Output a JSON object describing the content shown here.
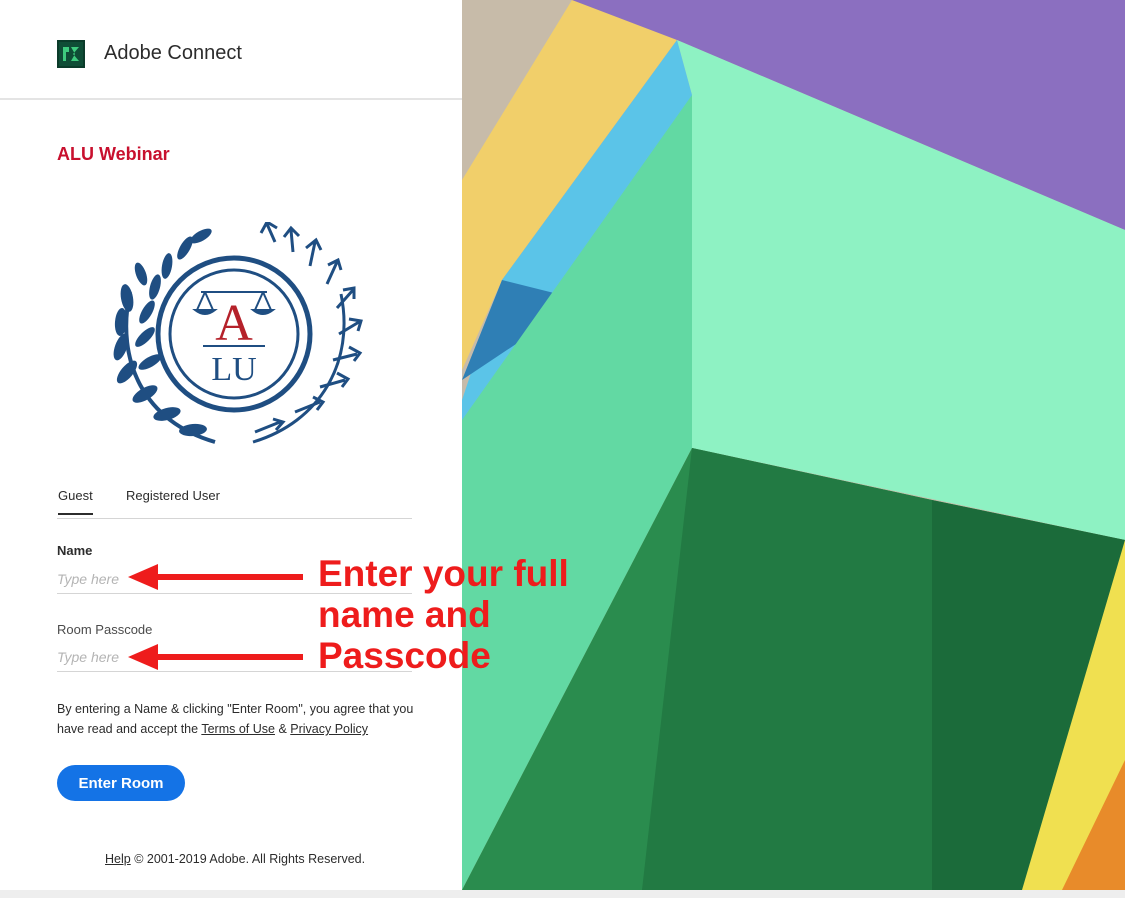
{
  "header": {
    "app_title": "Adobe Connect",
    "logo_icon": "adobe-connect-logo-icon"
  },
  "room": {
    "title": "ALU Webinar",
    "logo": {
      "icon": "scales-of-justice-laurel-icon",
      "letter_top": "A",
      "letter_bottom": "LU"
    }
  },
  "tabs": [
    {
      "label": "Guest",
      "selected": true
    },
    {
      "label": "Registered User",
      "selected": false
    }
  ],
  "form": {
    "name_label": "Name",
    "name_placeholder": "Type here",
    "passcode_label": "Room Passcode",
    "passcode_placeholder": "Type here",
    "consent_prefix": "By entering a Name & clicking \"Enter Room\", you agree that you have read and accept the ",
    "terms_link": "Terms of Use",
    "consent_and": " & ",
    "privacy_link": "Privacy Policy",
    "enter_button": "Enter Room"
  },
  "footer": {
    "help_link": "Help",
    "copyright": " © 2001-2019 Adobe. All Rights Reserved."
  },
  "annotation": {
    "text": "Enter your full\nname and\nPasscode",
    "color": "#ee1c1c"
  },
  "colors": {
    "accent": "#1473e6",
    "room_title": "#c8102e",
    "logo_navy": "#1f4e82",
    "logo_red": "#b5212a"
  }
}
